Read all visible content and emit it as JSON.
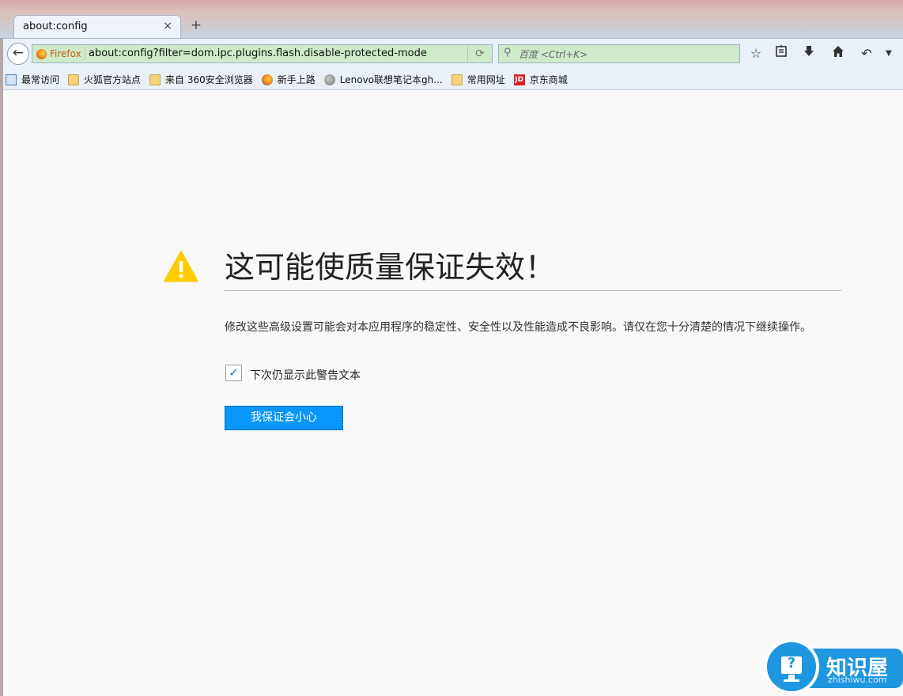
{
  "tab": {
    "title": "about:config",
    "close": "×",
    "new_tab": "+"
  },
  "navbar": {
    "identity_label": "Firefox",
    "url": "about:config?filter=dom.ipc.plugins.flash.disable-protected-mode",
    "search_placeholder": "百度 <Ctrl+K>"
  },
  "bookmarks": [
    {
      "label": "最常访问",
      "icon": "recent-icon"
    },
    {
      "label": "火狐官方站点",
      "icon": "folder-icon"
    },
    {
      "label": "来自 360安全浏览器",
      "icon": "folder-icon"
    },
    {
      "label": "新手上路",
      "icon": "firefox-icon"
    },
    {
      "label": "Lenovo联想笔记本gh...",
      "icon": "globe-icon"
    },
    {
      "label": "常用网址",
      "icon": "folder-icon"
    },
    {
      "label": "京东商城",
      "icon": "jd-icon",
      "icon_text": "JD"
    }
  ],
  "warning": {
    "title": "这可能使质量保证失效！",
    "description": "修改这些高级设置可能会对本应用程序的稳定性、安全性以及性能造成不良影响。请仅在您十分清楚的情况下继续操作。",
    "checkbox_label": "下次仍显示此警告文本",
    "checkbox_checked": true,
    "accept_button": "我保证会小心"
  },
  "watermark": {
    "name": "知识屋",
    "domain": "zhishiwu.com"
  },
  "colors": {
    "accent": "#0996f8",
    "warning": "#ffcc00",
    "urlbar": "#cfeacb"
  }
}
